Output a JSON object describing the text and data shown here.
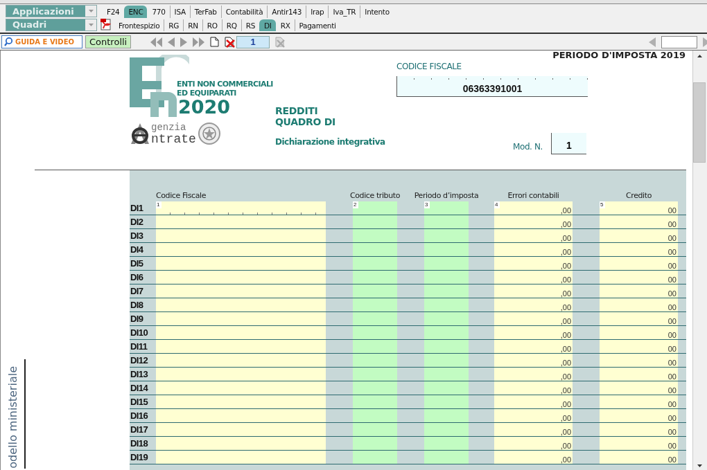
{
  "app_selector": {
    "value": "Applicazioni"
  },
  "app_tabs": [
    {
      "label": "F24",
      "selected": false
    },
    {
      "label": "ENC",
      "selected": true
    },
    {
      "label": "770",
      "selected": false
    },
    {
      "label": "ISA",
      "selected": false
    },
    {
      "label": "TerFab",
      "selected": false
    },
    {
      "label": "Contabilità",
      "selected": false
    },
    {
      "label": "Antir143",
      "selected": false
    },
    {
      "label": "Irap",
      "selected": false
    },
    {
      "label": "Iva_TR",
      "selected": false
    },
    {
      "label": "Intento",
      "selected": false
    }
  ],
  "section_selector": {
    "value": "Quadri"
  },
  "section_tabs": [
    {
      "label": "Frontespizio",
      "selected": false
    },
    {
      "label": "RG",
      "selected": false
    },
    {
      "label": "RN",
      "selected": false
    },
    {
      "label": "RO",
      "selected": false
    },
    {
      "label": "RQ",
      "selected": false
    },
    {
      "label": "RS",
      "selected": false
    },
    {
      "label": "DI",
      "selected": true
    },
    {
      "label": "RX",
      "selected": false
    },
    {
      "label": "Pagamenti",
      "selected": false
    }
  ],
  "toolbar": {
    "guide_button": "GUIDA E VIDEO",
    "checks_button": "Controlli",
    "page_number": "1"
  },
  "form": {
    "period_heading": "PERIODO D'IMPOSTA 2019",
    "logo": {
      "line_1": "ENTI NON COMMERCIALI",
      "line_2": "ED EQUIPARATI",
      "year": "2020",
      "agency_1": "genzia",
      "agency_2": "ntrate"
    },
    "title_1": "REDDITI",
    "title_2": "QUADRO DI",
    "subtitle": "Dichiarazione integrativa",
    "tax_code_label": "CODICE FISCALE",
    "tax_code": "06363391001",
    "module_label": "Mod. N.",
    "module_number": "1",
    "side_label": "odello ministeriale",
    "table": {
      "columns": [
        "Codice Fiscale",
        "Codice tributo",
        "Periodo d’imposta",
        "Errori contabili",
        "Credito"
      ],
      "field_numbers": [
        "1",
        "2",
        "3",
        "4",
        "5"
      ],
      "rows": [
        {
          "code": "DI1",
          "errori": ",00",
          "credito": "00"
        },
        {
          "code": "DI2",
          "errori": ",00",
          "credito": "00"
        },
        {
          "code": "DI3",
          "errori": ",00",
          "credito": "00"
        },
        {
          "code": "DI4",
          "errori": ",00",
          "credito": "00"
        },
        {
          "code": "DI5",
          "errori": ",00",
          "credito": "00"
        },
        {
          "code": "DI6",
          "errori": ",00",
          "credito": "00"
        },
        {
          "code": "DI7",
          "errori": ",00",
          "credito": "00"
        },
        {
          "code": "DI8",
          "errori": ",00",
          "credito": "00"
        },
        {
          "code": "DI9",
          "errori": ",00",
          "credito": "00"
        },
        {
          "code": "DI10",
          "errori": ",00",
          "credito": "00"
        },
        {
          "code": "DI11",
          "errori": ",00",
          "credito": "00"
        },
        {
          "code": "DI12",
          "errori": ",00",
          "credito": "00"
        },
        {
          "code": "DI13",
          "errori": ",00",
          "credito": "00"
        },
        {
          "code": "DI14",
          "errori": ",00",
          "credito": "00"
        },
        {
          "code": "DI15",
          "errori": ",00",
          "credito": "00"
        },
        {
          "code": "DI16",
          "errori": ",00",
          "credito": "00"
        },
        {
          "code": "DI17",
          "errori": ",00",
          "credito": "00"
        },
        {
          "code": "DI18",
          "errori": ",00",
          "credito": "00"
        },
        {
          "code": "DI19",
          "errori": ",00",
          "credito": "00"
        }
      ]
    }
  }
}
